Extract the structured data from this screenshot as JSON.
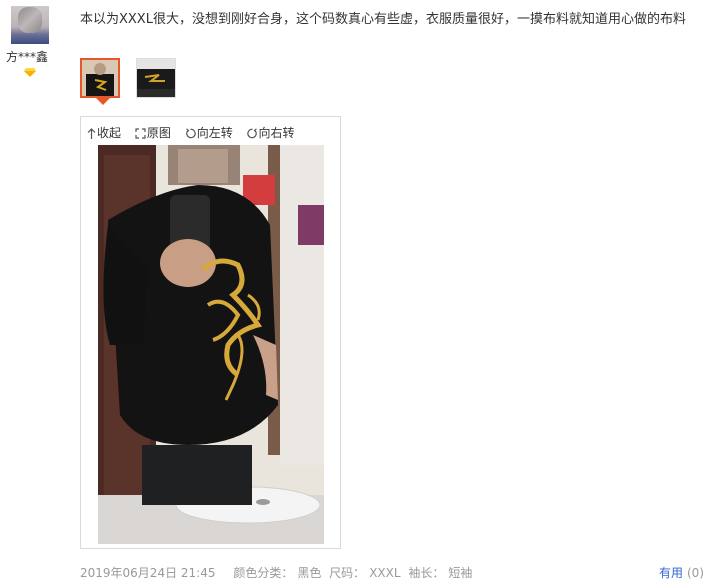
{
  "review": {
    "username": "方***鑫",
    "text": "本以为XXXL很大，没想到刚好合身，这个码数真心有些虚，衣服质量很好，一摸布料就知道用心做的布料",
    "thumbnails": [
      "photo-1",
      "photo-2"
    ],
    "viewer": {
      "collapse": "收起",
      "original": "原图",
      "rotate_left": "向左转",
      "rotate_right": "向右转"
    },
    "date": "2019年06月24日 21:45",
    "sku": {
      "color_label": "颜色分类：",
      "color_value": "黑色",
      "size_label": "尺码：",
      "size_value": "XXXL",
      "sleeve_label": "袖长：",
      "sleeve_value": "短袖"
    },
    "useful": {
      "label": "有用",
      "count": "(0)"
    }
  },
  "colors": {
    "accent": "#e4582b",
    "link": "#3366cc",
    "muted": "#999999",
    "vip": "#f5b400"
  },
  "icons": [
    "vip-diamond-icon",
    "collapse-arrow-icon",
    "fullscreen-icon",
    "rotate-left-icon",
    "rotate-right-icon"
  ]
}
